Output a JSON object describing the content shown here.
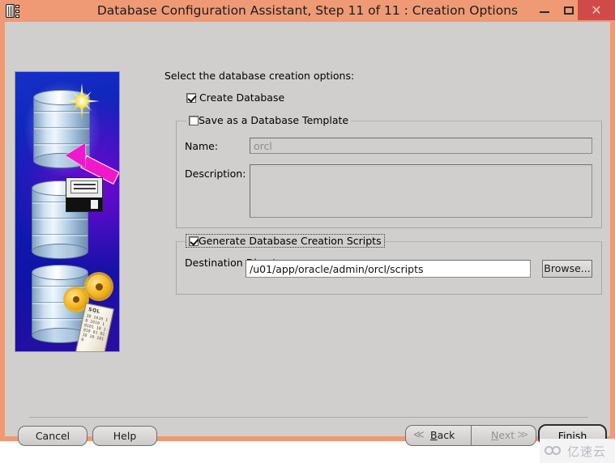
{
  "window": {
    "title": "Database Configuration Assistant, Step 11 of 11 : Creation Options",
    "icon": "database-card-icon",
    "titlebar_color": "#ef9a74",
    "client_color": "#d0cfcd",
    "controls": {
      "minimize": "–",
      "maximize": "□",
      "close": "✕"
    }
  },
  "illustration": {
    "name": "database-creation-illustration",
    "scroll_label": "SQL",
    "scroll_bits": "10 1010 10 1010 1 0101 10 1010 01 0110 10 1010"
  },
  "main": {
    "intro": "Select the database creation options:",
    "create_database": {
      "label": "Create Database",
      "checked": true
    },
    "template_group": {
      "legend": "Save as a Database Template",
      "checked": false,
      "name_label": "Name:",
      "name_value": "orcl",
      "name_placeholder": "orcl",
      "description_label": "Description:",
      "description_value": "",
      "description_placeholder": ""
    },
    "scripts_group": {
      "legend": "Generate Database Creation Scripts",
      "checked": true,
      "destination_label": "Destination Directory:",
      "destination_value": "/u01/app/oracle/admin/orcl/scripts",
      "destination_placeholder": "",
      "browse_label": "Browse..."
    }
  },
  "footer": {
    "cancel": "Cancel",
    "help": "Help",
    "back": "Back",
    "back_chevron": "≪",
    "next": "Next",
    "next_chevron": "≫",
    "finish": "Finish"
  },
  "watermark": {
    "text": "亿速云"
  }
}
